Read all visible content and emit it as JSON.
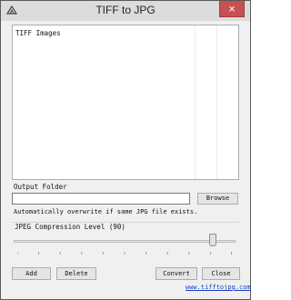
{
  "window": {
    "title": "TIFF to JPG",
    "close_glyph": "×"
  },
  "list": {
    "header": "TIFF Images"
  },
  "output": {
    "label": "Output Folder",
    "path_value": "",
    "browse_label": "Browse",
    "overwrite_note": "Automatically overwrite if same JPG file exists."
  },
  "compression": {
    "label": "JPEG Compression Level (90)",
    "value": 90,
    "min": 0,
    "max": 100
  },
  "buttons": {
    "add": "Add",
    "delete": "Delete",
    "convert": "Convert",
    "close": "Close"
  },
  "footer": {
    "link": "www.tifftojpg.com"
  },
  "colors": {
    "close_button": "#c75050",
    "link": "#1a3fc7"
  }
}
